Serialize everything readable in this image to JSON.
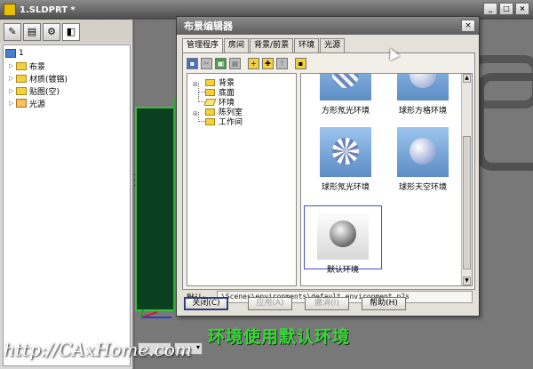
{
  "window": {
    "title": "1.SLDPRT *",
    "buttons": {
      "minimize": "_",
      "maximize": "□",
      "close": "×"
    }
  },
  "left_panel": {
    "tab_icons": [
      "part-icon",
      "property-icon",
      "configuration-icon",
      "scene-icon"
    ],
    "tree": [
      {
        "label": "1",
        "icon": "part-icon",
        "expanded": true
      },
      {
        "label": "布景",
        "icon": "folder-icon"
      },
      {
        "label": "材质(镀铬)",
        "icon": "folder-icon"
      },
      {
        "label": "贴图(空)",
        "icon": "folder-icon"
      },
      {
        "label": "光源",
        "icon": "light-icon"
      }
    ]
  },
  "dialog": {
    "title": "布景编辑器",
    "close": "×",
    "tabs": [
      "管理程序",
      "房间",
      "背景/前景",
      "环境",
      "光源"
    ],
    "active_tab": 0,
    "folders": [
      "背景",
      "底面",
      "环境",
      "陈列室",
      "工作间"
    ],
    "open_folder": "环境",
    "gallery": [
      {
        "label": "方形氖光环境",
        "style": "stripe"
      },
      {
        "label": "球形方格环境",
        "style": "grid"
      },
      {
        "label": "球形氖光环境",
        "style": "swirl"
      },
      {
        "label": "球形天空环境",
        "style": "sky"
      },
      {
        "label": "默认环境",
        "style": "chrome",
        "selected": true
      }
    ],
    "default_label": "默认:",
    "default_path": "\\Scenes\\environments\\default environment.p2s",
    "buttons": {
      "close": "关闭(C)",
      "apply": "应用(A)",
      "cancel": "撤消(I)",
      "help": "帮助(H)"
    }
  },
  "caption": "环境使用默认环境",
  "watermark": "http://CAxHome.com",
  "colors": {
    "caption": "#3fd23f",
    "title_bar": "#5e5e5e",
    "selection": "#3d4fd1"
  }
}
